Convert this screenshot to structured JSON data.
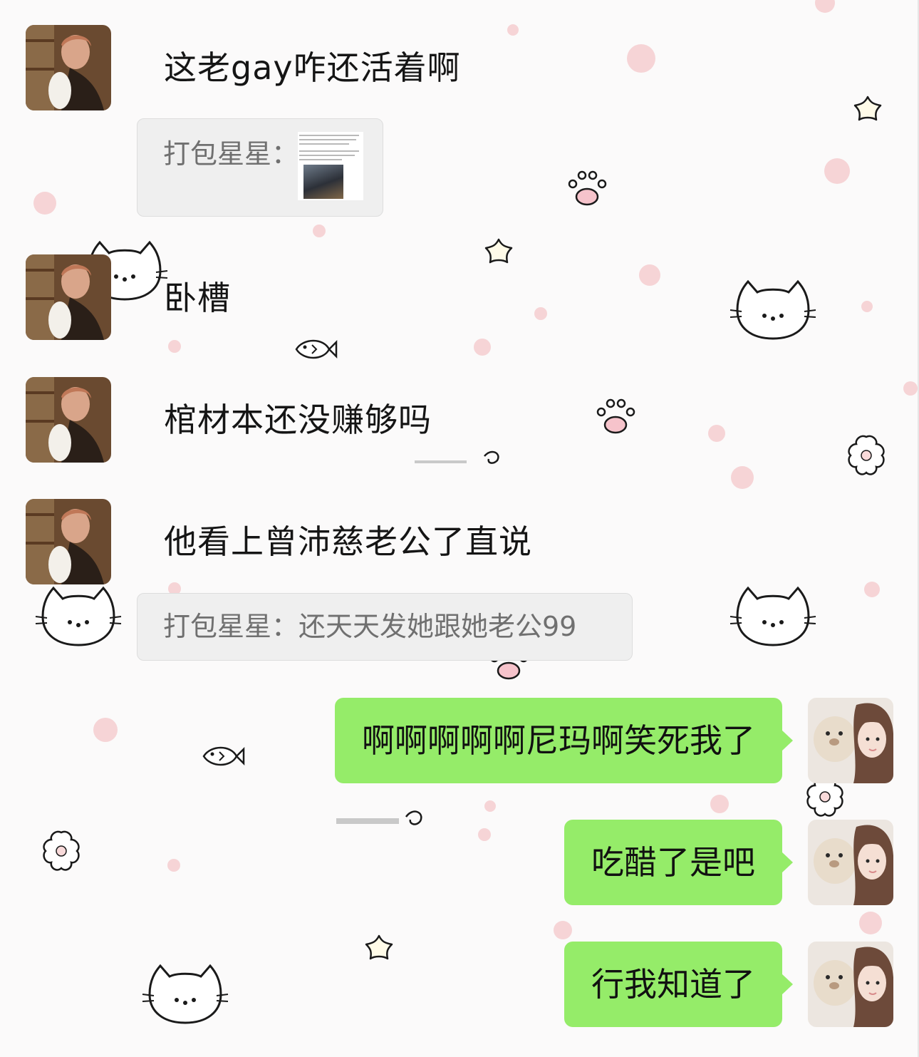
{
  "chat": {
    "messages": [
      {
        "side": "left",
        "text": "这老gay咋还活着啊"
      },
      {
        "side": "left",
        "quote_label": "打包星星：",
        "quote_type": "image-card"
      },
      {
        "side": "left",
        "text": "卧槽"
      },
      {
        "side": "left",
        "text": "棺材本还没赚够吗"
      },
      {
        "side": "left",
        "text": "他看上曾沛慈老公了直说"
      },
      {
        "side": "left",
        "quote_text": "打包星星：还天天发她跟她老公99"
      },
      {
        "side": "right",
        "text": "啊啊啊啊啊尼玛啊笑死我了"
      },
      {
        "side": "right",
        "text": "吃醋了是吧"
      },
      {
        "side": "right",
        "text": "行我知道了"
      }
    ]
  },
  "colors": {
    "right_bubble": "#95ec69",
    "quote_bg": "#efefef",
    "quote_text": "#707070",
    "wallpaper_dot": "#f6d4d6"
  },
  "icons": [
    "hello-kitty-face-icon",
    "paw-print-icon",
    "fish-icon",
    "star-flower-icon",
    "flower-icon"
  ]
}
